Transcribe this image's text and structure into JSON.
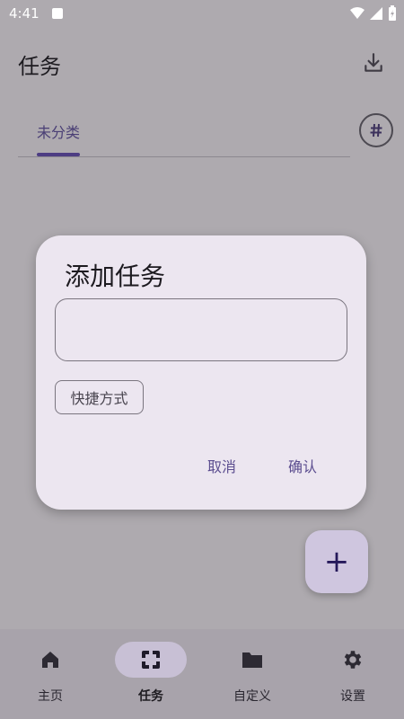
{
  "status_bar": {
    "time": "4:41"
  },
  "app_bar": {
    "title": "任务"
  },
  "tabs": [
    {
      "label": "未分类",
      "selected": true
    }
  ],
  "dialog": {
    "title": "添加任务",
    "input_value": "",
    "shortcut_label": "快捷方式",
    "cancel_label": "取消",
    "confirm_label": "确认"
  },
  "fab": {
    "icon": "+"
  },
  "bottom_nav": {
    "items": [
      {
        "label": "主页",
        "icon": "home-icon",
        "selected": false
      },
      {
        "label": "任务",
        "icon": "task-icon",
        "selected": true
      },
      {
        "label": "自定义",
        "icon": "folder-icon",
        "selected": false
      },
      {
        "label": "设置",
        "icon": "settings-icon",
        "selected": false
      }
    ]
  },
  "colors": {
    "background_scrim": "#aeaaaf",
    "dialog_bg": "#ece6f0",
    "accent": "#4d3d83",
    "fab_bg": "#cfc6df",
    "nav_active_pill": "#c8c0d5"
  }
}
